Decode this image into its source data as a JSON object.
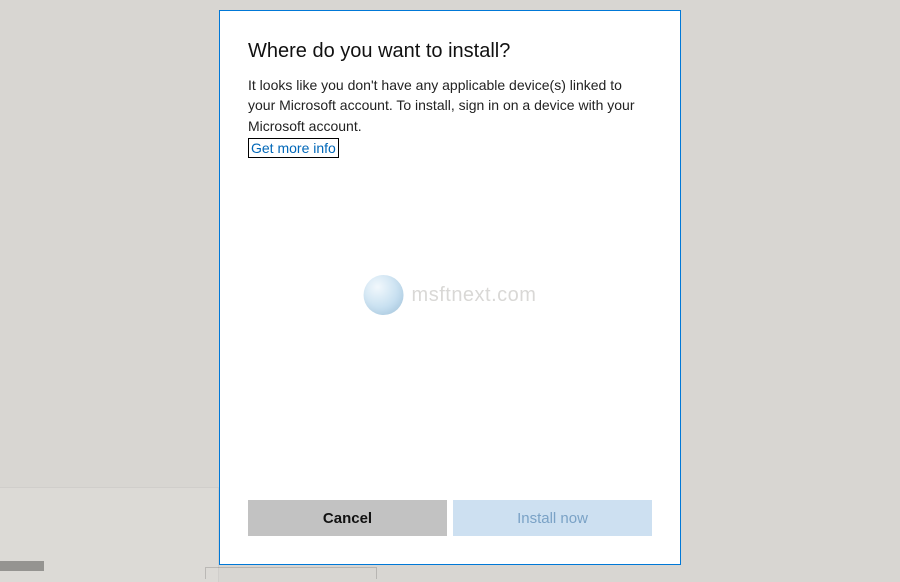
{
  "dialog": {
    "title": "Where do you want to install?",
    "body": "It looks like you don't have any applicable device(s) linked to your Microsoft account. To install, sign in on a device with your Microsoft account.",
    "info_link": "Get more info"
  },
  "buttons": {
    "cancel": "Cancel",
    "install": "Install now"
  },
  "watermark": {
    "text": "msftnext.com"
  }
}
